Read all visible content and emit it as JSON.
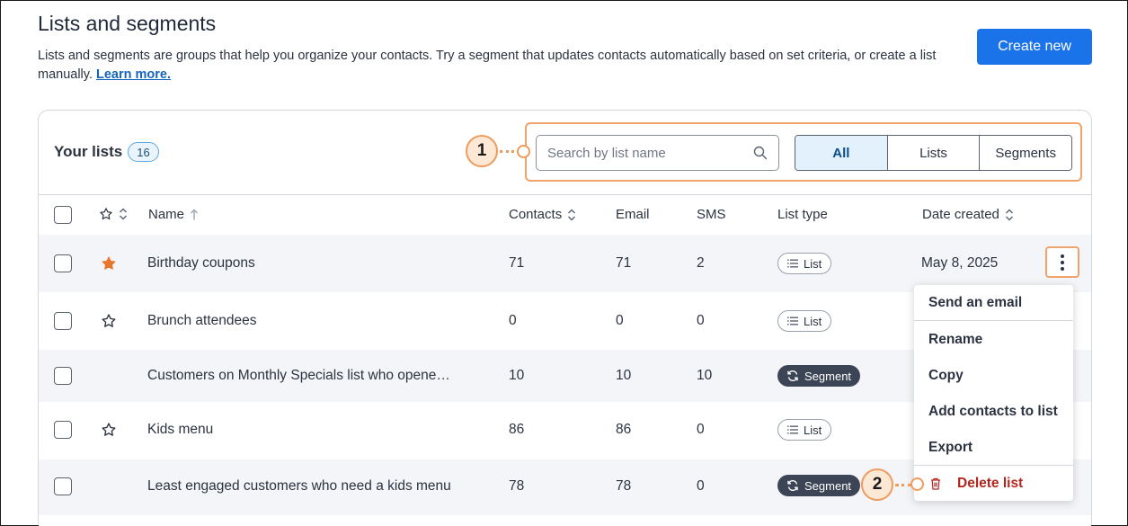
{
  "header": {
    "title": "Lists and segments",
    "description": "Lists and segments are groups that help you organize your contacts. Try a segment that updates contacts automatically based on set criteria, or create a list manually.",
    "learn_more": "Learn more.",
    "create_button": "Create new"
  },
  "lists_panel": {
    "title": "Your lists",
    "count": "16",
    "search_placeholder": "Search by list name",
    "filters": [
      "All",
      "Lists",
      "Segments"
    ],
    "active_filter": "All"
  },
  "callouts": [
    "1",
    "2"
  ],
  "table": {
    "columns": {
      "name": "Name",
      "contacts": "Contacts",
      "email": "Email",
      "sms": "SMS",
      "list_type": "List type",
      "date_created": "Date created"
    },
    "rows": [
      {
        "name": "Birthday coupons",
        "contacts": "71",
        "email": "71",
        "sms": "2",
        "type": "List",
        "date": "May 8, 2025",
        "starred": true
      },
      {
        "name": "Brunch attendees",
        "contacts": "0",
        "email": "0",
        "sms": "0",
        "type": "List",
        "date": "",
        "starred": false
      },
      {
        "name": "Customers on Monthly Specials list who opene…",
        "contacts": "10",
        "email": "10",
        "sms": "10",
        "type": "Segment",
        "date": "",
        "starred": false
      },
      {
        "name": "Kids menu",
        "contacts": "86",
        "email": "86",
        "sms": "0",
        "type": "List",
        "date": "",
        "starred": false
      },
      {
        "name": "Least engaged customers who need a kids menu",
        "contacts": "78",
        "email": "78",
        "sms": "0",
        "type": "Segment",
        "date": "",
        "starred": false
      }
    ]
  },
  "action_menu": {
    "items": [
      "Send an email",
      "Rename",
      "Copy",
      "Add contacts to list",
      "Export"
    ],
    "delete": "Delete list"
  },
  "colors": {
    "primary": "#1a73e8",
    "callout": "#ee9b5e",
    "star_filled": "#e8772e",
    "danger": "#b3261e",
    "segment_pill": "#3b4556"
  }
}
